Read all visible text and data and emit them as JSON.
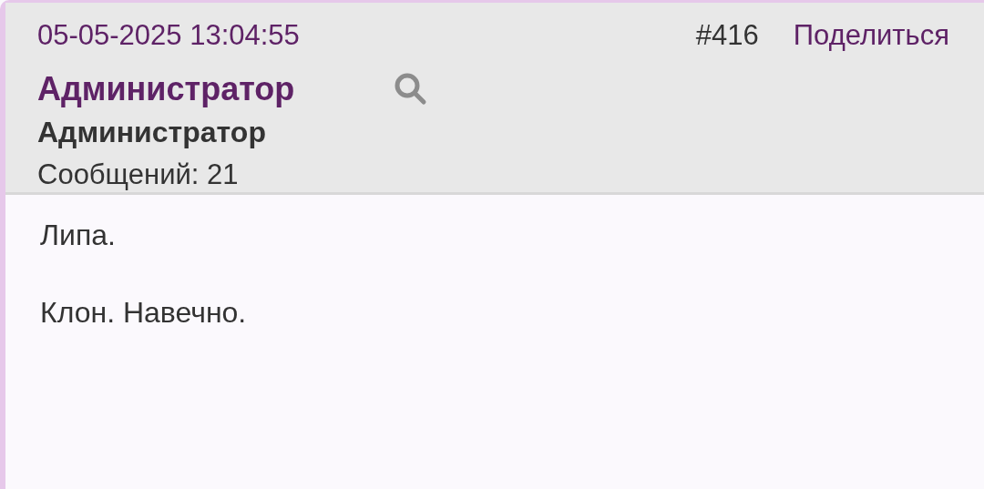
{
  "post": {
    "date": "05-05-2025 13:04:55",
    "number": "#416",
    "share": "Поделиться",
    "author": {
      "name": "Администратор",
      "role": "Администратор",
      "posts": "Сообщений: 21"
    },
    "body": [
      "Липа.",
      "Клон. Навечно."
    ]
  }
}
